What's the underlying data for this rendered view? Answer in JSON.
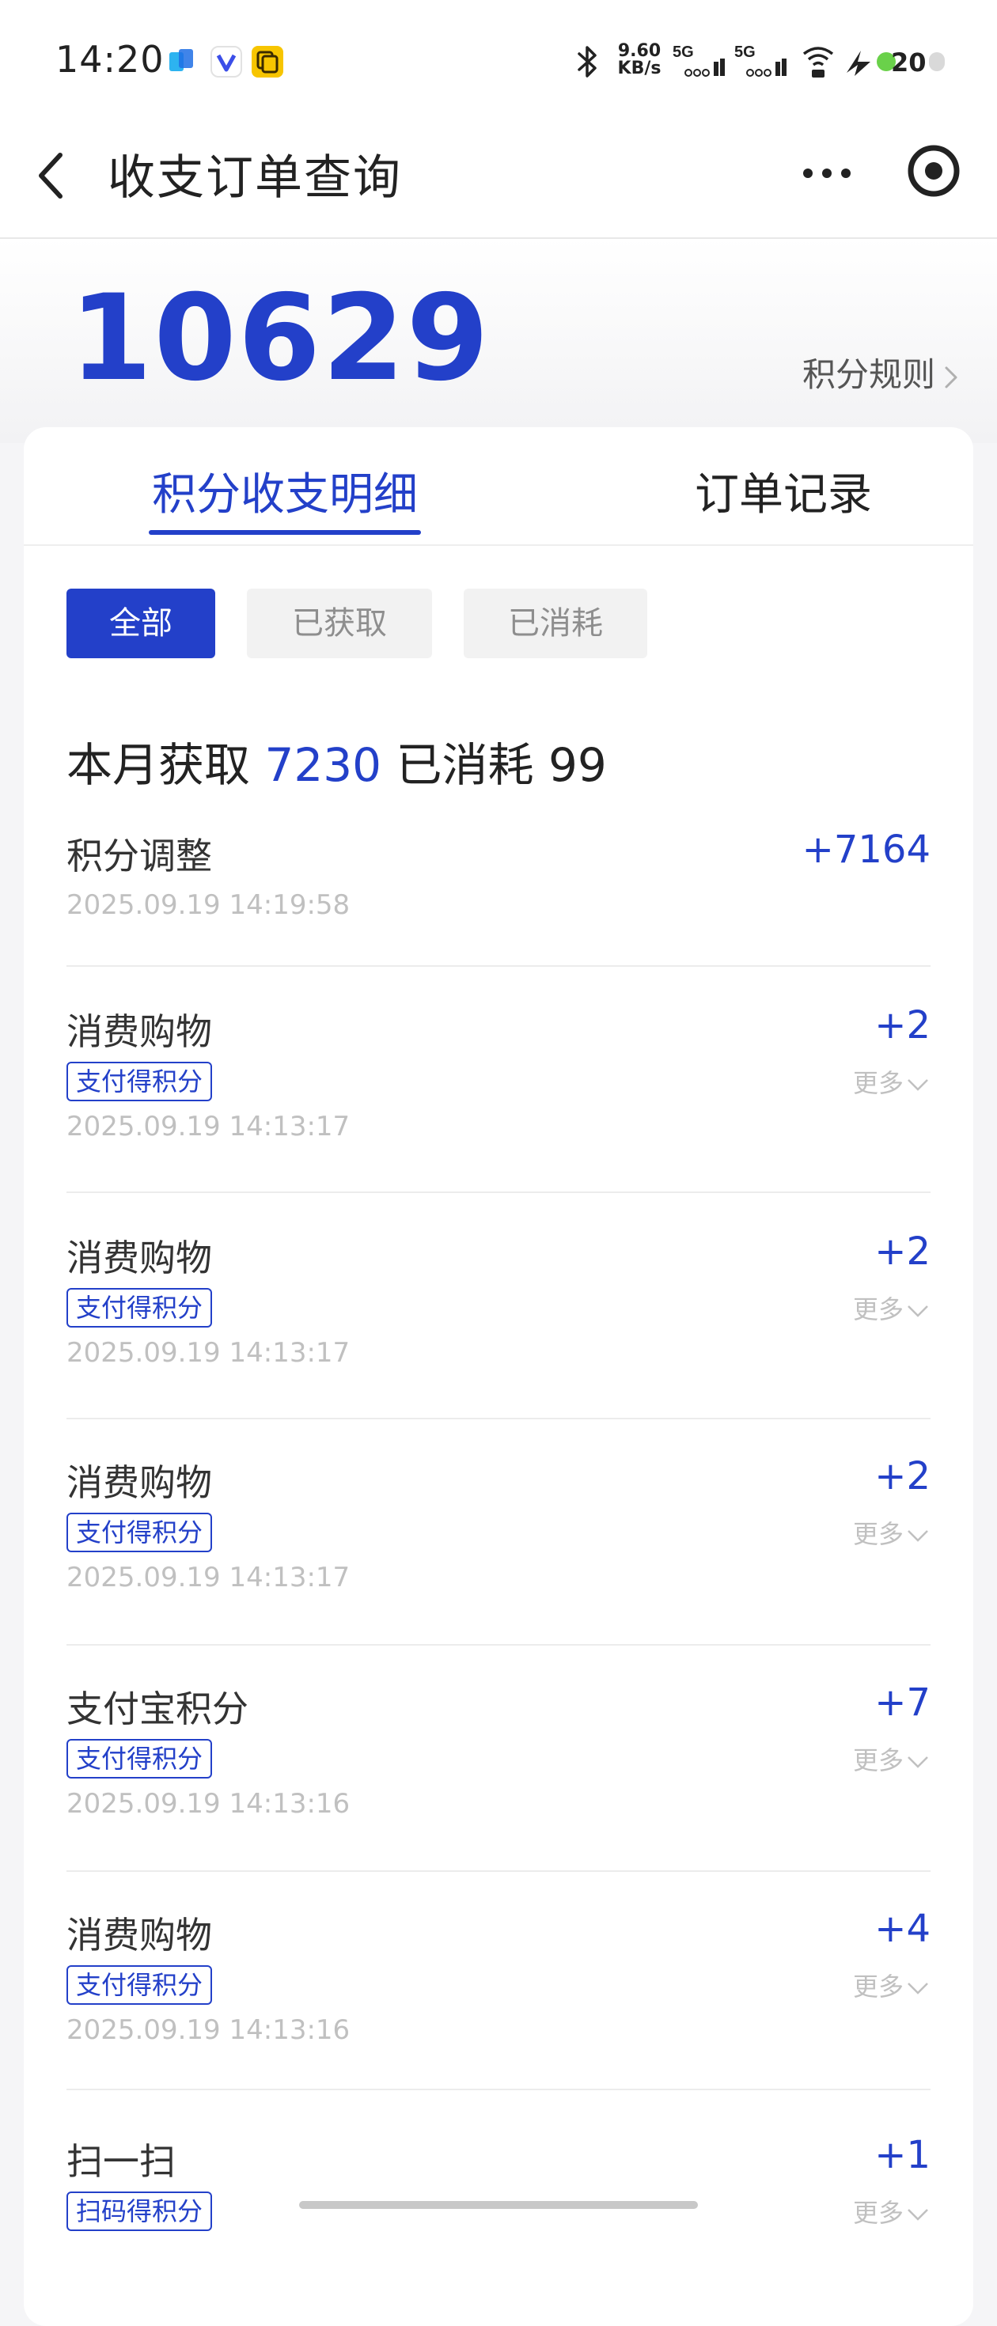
{
  "status_bar": {
    "time": "14:20",
    "net_speed_value": "9.60",
    "net_speed_unit": "KB/s",
    "signal_1": "5G",
    "signal_2": "5G",
    "battery": "20"
  },
  "nav": {
    "title": "收支订单查询"
  },
  "points": {
    "value": "10629",
    "rule_link": "积分规则"
  },
  "tabs": [
    {
      "label": "积分收支明细",
      "active": true
    },
    {
      "label": "订单记录",
      "active": false
    }
  ],
  "filters": [
    {
      "label": "全部",
      "selected": true
    },
    {
      "label": "已获取",
      "selected": false
    },
    {
      "label": "已消耗",
      "selected": false
    }
  ],
  "summary": {
    "earned_label": "本月获取",
    "earned_value": "7230",
    "spent_label": "已消耗",
    "spent_value": "99"
  },
  "records": [
    {
      "title": "积分调整",
      "amount": "+7164",
      "tag": "",
      "time": "2025.09.19 14:19:58",
      "more": ""
    },
    {
      "title": "消费购物",
      "amount": "+2",
      "tag": "支付得积分",
      "time": "2025.09.19 14:13:17",
      "more": "更多"
    },
    {
      "title": "消费购物",
      "amount": "+2",
      "tag": "支付得积分",
      "time": "2025.09.19 14:13:17",
      "more": "更多"
    },
    {
      "title": "消费购物",
      "amount": "+2",
      "tag": "支付得积分",
      "time": "2025.09.19 14:13:17",
      "more": "更多"
    },
    {
      "title": "支付宝积分",
      "amount": "+7",
      "tag": "支付得积分",
      "time": "2025.09.19 14:13:16",
      "more": "更多"
    },
    {
      "title": "消费购物",
      "amount": "+4",
      "tag": "支付得积分",
      "time": "2025.09.19 14:13:16",
      "more": "更多"
    },
    {
      "title": "扫一扫",
      "amount": "+1",
      "tag": "扫码得积分",
      "time": "",
      "more": "更多"
    }
  ],
  "colors": {
    "accent": "#2340c9",
    "muted_text": "#c0c0c0",
    "chip_bg": "#f2f2f2"
  }
}
